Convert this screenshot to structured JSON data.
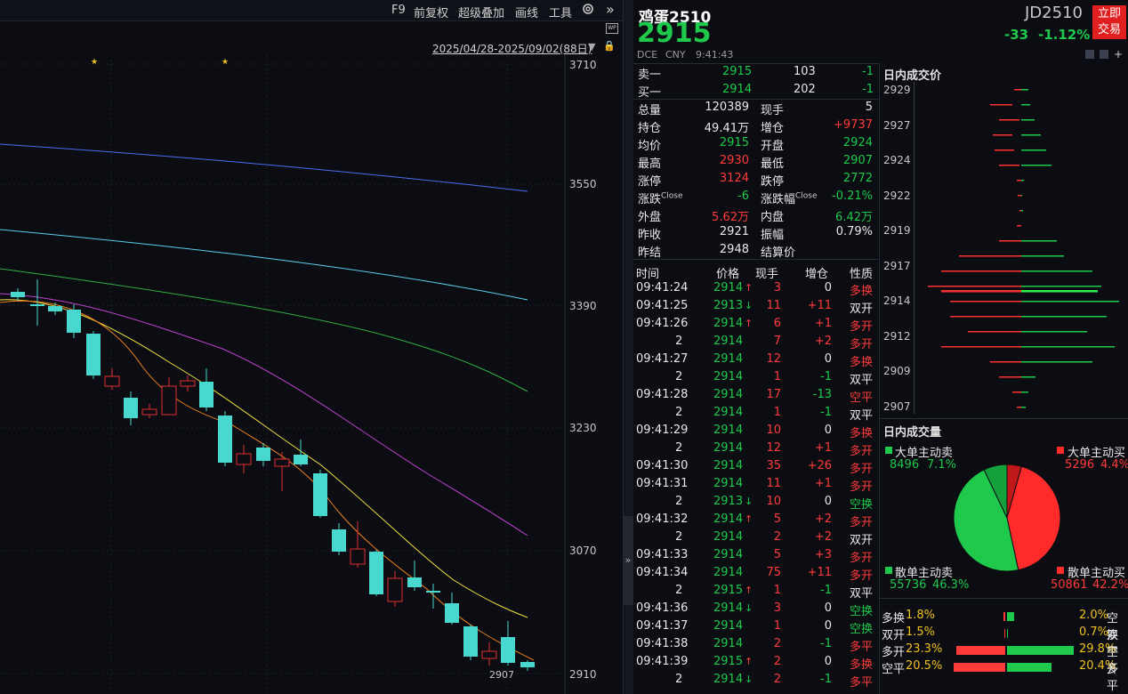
{
  "toolbar": {
    "items": [
      "F9",
      "前复权",
      "超级叠加",
      "画线",
      "工具"
    ],
    "range": "2025/04/28-2025/09/02(88日)",
    "expand_glyph": "»",
    "dropdown_glyph": "▼",
    "lock_glyph": "🔒",
    "wp_label": "WP"
  },
  "chart": {
    "price_labels": [
      "3710",
      "3550",
      "3390",
      "3230",
      "3070",
      "2910"
    ],
    "last_price_tag": "2907",
    "collapse_glyph": "»"
  },
  "quote": {
    "name": "鸡蛋2510",
    "price": "2915",
    "code": "JD2510",
    "change": "-33",
    "change_pct": "-1.12%",
    "trade_btn_line1": "立即",
    "trade_btn_line2": "交易",
    "exchange": "DCE",
    "currency": "CNY",
    "time": "9:41:43"
  },
  "orderbook": {
    "sell1": {
      "label": "卖一",
      "price": "2915",
      "vol": "103",
      "chg": "-1"
    },
    "buy1": {
      "label": "买一",
      "price": "2914",
      "vol": "202",
      "chg": "-1"
    }
  },
  "stats": [
    {
      "l1": "总量",
      "v1": "120389",
      "l2": "现手",
      "v2": "5"
    },
    {
      "l1": "持仓",
      "v1": "49.41万",
      "l2": "增仓",
      "v2": "+9737"
    },
    {
      "l1": "均价",
      "v1": "2915",
      "l2": "开盘",
      "v2": "2924"
    },
    {
      "l1": "最高",
      "v1": "2930",
      "l2": "最低",
      "v2": "2907"
    },
    {
      "l1": "涨停",
      "v1": "3124",
      "l2": "跌停",
      "v2": "2772"
    },
    {
      "l1": "涨跌",
      "l1s": "Close",
      "v1": "-6",
      "l2": "涨跌幅",
      "l2s": "Close",
      "v2": "-0.21%"
    },
    {
      "l1": "外盘",
      "v1": "5.62万",
      "l2": "内盘",
      "v2": "6.42万"
    },
    {
      "l1": "昨收",
      "v1": "2921",
      "l2": "振幅",
      "v2": "0.79%"
    },
    {
      "l1": "昨结",
      "v1": "2948",
      "l2": "结算价",
      "v2": ""
    }
  ],
  "stat_colors": [
    [
      "white",
      "white"
    ],
    [
      "white",
      "red"
    ],
    [
      "green",
      "green"
    ],
    [
      "red",
      "green"
    ],
    [
      "red",
      "green"
    ],
    [
      "green",
      "green"
    ],
    [
      "red",
      "green"
    ],
    [
      "white",
      "white"
    ],
    [
      "white",
      "white"
    ]
  ],
  "ticks": {
    "headers": [
      "时间",
      "价格",
      "现手",
      "增仓",
      "性质"
    ],
    "rows": [
      {
        "t": "09:41:24",
        "p": "2914",
        "a": "up",
        "v": "3",
        "oi": "0",
        "n": "多换"
      },
      {
        "t": "09:41:25",
        "p": "2913",
        "a": "dn",
        "v": "11",
        "oi": "+11",
        "n": "双开"
      },
      {
        "t": "09:41:26",
        "p": "2914",
        "a": "up",
        "v": "6",
        "oi": "+1",
        "n": "多开"
      },
      {
        "t": "2",
        "p": "2914",
        "a": "",
        "v": "7",
        "oi": "+2",
        "n": "多开"
      },
      {
        "t": "09:41:27",
        "p": "2914",
        "a": "",
        "v": "12",
        "oi": "0",
        "n": "多换"
      },
      {
        "t": "2",
        "p": "2914",
        "a": "",
        "v": "1",
        "oi": "-1",
        "n": "双平"
      },
      {
        "t": "09:41:28",
        "p": "2914",
        "a": "",
        "v": "17",
        "oi": "-13",
        "n": "空平"
      },
      {
        "t": "2",
        "p": "2914",
        "a": "",
        "v": "1",
        "oi": "-1",
        "n": "双平"
      },
      {
        "t": "09:41:29",
        "p": "2914",
        "a": "",
        "v": "10",
        "oi": "0",
        "n": "多换"
      },
      {
        "t": "2",
        "p": "2914",
        "a": "",
        "v": "12",
        "oi": "+1",
        "n": "多开"
      },
      {
        "t": "09:41:30",
        "p": "2914",
        "a": "",
        "v": "35",
        "oi": "+26",
        "n": "多开"
      },
      {
        "t": "09:41:31",
        "p": "2914",
        "a": "",
        "v": "11",
        "oi": "+1",
        "n": "多开"
      },
      {
        "t": "2",
        "p": "2913",
        "a": "dn",
        "v": "10",
        "oi": "0",
        "n": "空换"
      },
      {
        "t": "09:41:32",
        "p": "2914",
        "a": "up",
        "v": "5",
        "oi": "+2",
        "n": "多开"
      },
      {
        "t": "2",
        "p": "2914",
        "a": "",
        "v": "2",
        "oi": "+2",
        "n": "双开"
      },
      {
        "t": "09:41:33",
        "p": "2914",
        "a": "",
        "v": "5",
        "oi": "+3",
        "n": "多开"
      },
      {
        "t": "09:41:34",
        "p": "2914",
        "a": "",
        "v": "75",
        "oi": "+11",
        "n": "多开"
      },
      {
        "t": "2",
        "p": "2915",
        "a": "up",
        "v": "1",
        "oi": "-1",
        "n": "双平"
      },
      {
        "t": "09:41:36",
        "p": "2914",
        "a": "dn",
        "v": "3",
        "oi": "0",
        "n": "空换"
      },
      {
        "t": "09:41:37",
        "p": "2914",
        "a": "",
        "v": "1",
        "oi": "0",
        "n": "空换"
      },
      {
        "t": "09:41:38",
        "p": "2914",
        "a": "",
        "v": "2",
        "oi": "-1",
        "n": "多平"
      },
      {
        "t": "09:41:39",
        "p": "2915",
        "a": "up",
        "v": "2",
        "oi": "0",
        "n": "多换"
      },
      {
        "t": "2",
        "p": "2914",
        "a": "dn",
        "v": "2",
        "oi": "-1",
        "n": "多平"
      }
    ]
  },
  "vap": {
    "title": "日内成交价",
    "labels": [
      "2929",
      "2927",
      "2924",
      "2922",
      "2919",
      "2917",
      "2914",
      "2912",
      "2909",
      "2907"
    ]
  },
  "volume_split": {
    "title": "日内成交量",
    "big_sell_label": "大单主动卖",
    "big_sell_vol": "8496",
    "big_sell_pct": "7.1%",
    "big_buy_label": "大单主动买",
    "big_buy_vol": "5296",
    "big_buy_pct": "4.4%",
    "small_sell_label": "散单主动卖",
    "small_sell_vol": "55736",
    "small_sell_pct": "46.3%",
    "small_buy_label": "散单主动买",
    "small_buy_vol": "50861",
    "small_buy_pct": "42.2%",
    "colors": {
      "red": "#ff2a2a",
      "green": "#1ec94c"
    }
  },
  "position_flow": {
    "left": [
      {
        "label": "多换",
        "pct": "1.8%"
      },
      {
        "label": "双开",
        "pct": "1.5%"
      },
      {
        "label": "多开",
        "pct": "23.3%"
      },
      {
        "label": "空平",
        "pct": "20.5%"
      }
    ],
    "right": [
      {
        "label": "空换",
        "pct": "2.0%"
      },
      {
        "label": "双平",
        "pct": "0.7%"
      },
      {
        "label": "空开",
        "pct": "29.8%"
      },
      {
        "label": "多平",
        "pct": "20.4%"
      }
    ]
  }
}
